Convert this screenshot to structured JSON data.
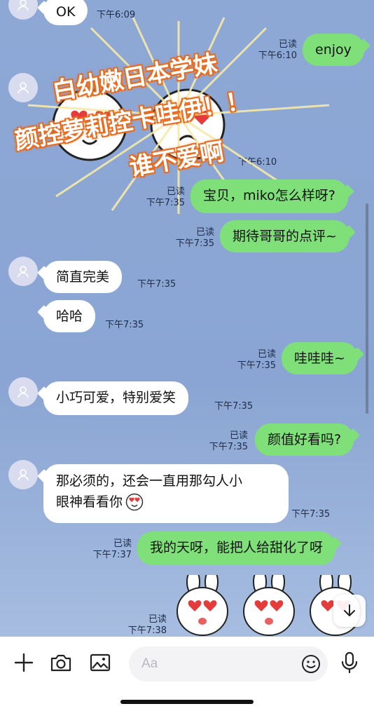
{
  "messages": {
    "m1": {
      "text": "OK",
      "time": "下午6:09"
    },
    "m2": {
      "text": "enjoy",
      "read": "已读",
      "time": "下午6:10"
    },
    "m3": {
      "time": "下午6:10"
    },
    "m4": {
      "text": "宝贝，miko怎么样呀?",
      "read": "已读",
      "time": "下午7:35"
    },
    "m5": {
      "text": "期待哥哥的点评~",
      "read": "已读",
      "time": "下午7:35"
    },
    "m6": {
      "text": "简直完美",
      "time": "下午7:35"
    },
    "m7": {
      "text": "哈哈",
      "time": "下午7:35"
    },
    "m8": {
      "text": "哇哇哇~",
      "read": "已读",
      "time": "下午7:35"
    },
    "m9": {
      "text": "小巧可爱，特别爱笑",
      "time": "下午7:35"
    },
    "m10": {
      "text": "颜值好看吗?",
      "read": "已读",
      "time": "下午7:35"
    },
    "m11": {
      "line1": "那必须的，还会一直用那勾人小",
      "line2": "眼神看看你",
      "time": "下午7:35"
    },
    "m12": {
      "text": "我的天呀，能把人给甜化了呀",
      "read": "已读",
      "time": "下午7:37"
    },
    "m13": {
      "read": "已读",
      "time": "下午7:38"
    }
  },
  "overlay": {
    "line1": "白幼嫩日本学妹",
    "line2": "颜控萝莉控卡哇伊！！",
    "line3": "谁不爱啊"
  },
  "composer": {
    "placeholder": "Aa"
  },
  "colors": {
    "outgoing": "#7fe07a",
    "incoming": "#ffffff",
    "background": "#8ea7d4",
    "overlay_outline": "#e96c1f"
  },
  "icons": [
    "plus-icon",
    "camera-icon",
    "image-icon",
    "emoji-icon",
    "microphone-icon",
    "arrow-down-icon",
    "avatar-icon"
  ]
}
